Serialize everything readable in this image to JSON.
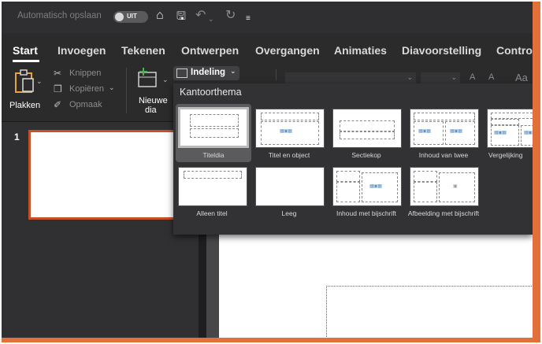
{
  "titlebar": {
    "autosave_label": "Automatisch opslaan",
    "toggle_text": "UIT"
  },
  "tabs": [
    "Start",
    "Invoegen",
    "Tekenen",
    "Ontwerpen",
    "Overgangen",
    "Animaties",
    "Diavoorstelling",
    "Control"
  ],
  "ribbon": {
    "paste": "Plakken",
    "cut": "Knippen",
    "copy": "Kopiëren",
    "format": "Opmaak",
    "new_slide_1": "Nieuwe",
    "new_slide_2": "dia",
    "layout_button": "Indeling",
    "font_a_up": "A",
    "font_a_down": "A",
    "font_aa": "Aa"
  },
  "slide_pane": {
    "slide_number": "1"
  },
  "layout_menu": {
    "title": "Kantoorthema",
    "items": [
      {
        "label": "Titeldia"
      },
      {
        "label": "Titel en object"
      },
      {
        "label": "Sectiekop"
      },
      {
        "label": "Inhoud van twee"
      },
      {
        "label": "Vergelijking"
      },
      {
        "label": "Alleen titel"
      },
      {
        "label": "Leeg"
      },
      {
        "label": "Inhoud met bijschrift"
      },
      {
        "label": "Afbeelding met bijschrift"
      }
    ],
    "selected": "Titeldia"
  },
  "colors": {
    "accent": "#e2703a",
    "thumb_border": "#c4512a",
    "background": "#2a2a2a"
  }
}
